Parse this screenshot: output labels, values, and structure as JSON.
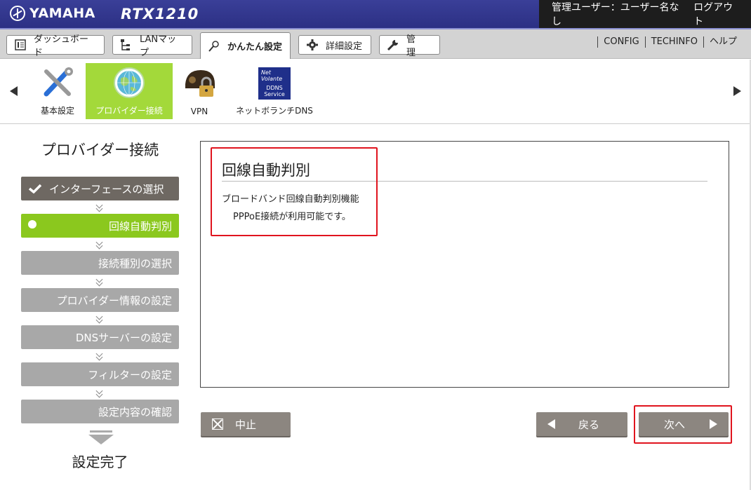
{
  "header": {
    "brand": "YAMAHA",
    "model": "RTX1210",
    "user_status": "管理ユーザー：ユーザー名なし",
    "logout": "ログアウト"
  },
  "tabs": [
    {
      "label": "ダッシュボード",
      "icon": "dashboard-icon"
    },
    {
      "label": "LANマップ",
      "icon": "lan-map-icon"
    },
    {
      "label": "かんたん設定",
      "icon": "easy-setup-icon",
      "active": true
    },
    {
      "label": "詳細設定",
      "icon": "gear-icon"
    },
    {
      "label": "管　理",
      "icon": "wrench-icon"
    }
  ],
  "top_links": [
    "CONFIG",
    "TECHINFO",
    "ヘルプ"
  ],
  "strip": {
    "items": [
      {
        "label": "基本設定",
        "icon": "tools-icon"
      },
      {
        "label": "プロバイダー接続",
        "icon": "globe-icon",
        "active": true
      },
      {
        "label": "VPN",
        "icon": "vpn-lock-icon"
      },
      {
        "label": "ネットボランチDNS",
        "icon": "ddns-icon",
        "icon_text": [
          "Net",
          "Volante",
          "DDNS",
          "Service"
        ]
      }
    ]
  },
  "sidebar": {
    "title": "プロバイダー接続",
    "steps": [
      {
        "label": "インターフェースの選択",
        "state": "done"
      },
      {
        "label": "回線自動判別",
        "state": "current"
      },
      {
        "label": "接続種別の選択",
        "state": "pending"
      },
      {
        "label": "プロバイダー情報の設定",
        "state": "pending"
      },
      {
        "label": "DNSサーバーの設定",
        "state": "pending"
      },
      {
        "label": "フィルターの設定",
        "state": "pending"
      },
      {
        "label": "設定内容の確認",
        "state": "pending"
      }
    ],
    "finish": "設定完了"
  },
  "panel": {
    "title": "回線自動判別",
    "line1": "ブロードバンド回線自動判別機能",
    "line2": "PPPoE接続が利用可能です。"
  },
  "buttons": {
    "cancel": "中止",
    "back": "戻る",
    "next": "次へ"
  },
  "colors": {
    "header_bg": "#2c3084",
    "accent_green": "#8bc81e",
    "step_done": "#6e6862",
    "step_pending": "#a8a8a8",
    "highlight_red": "#e0141e"
  }
}
